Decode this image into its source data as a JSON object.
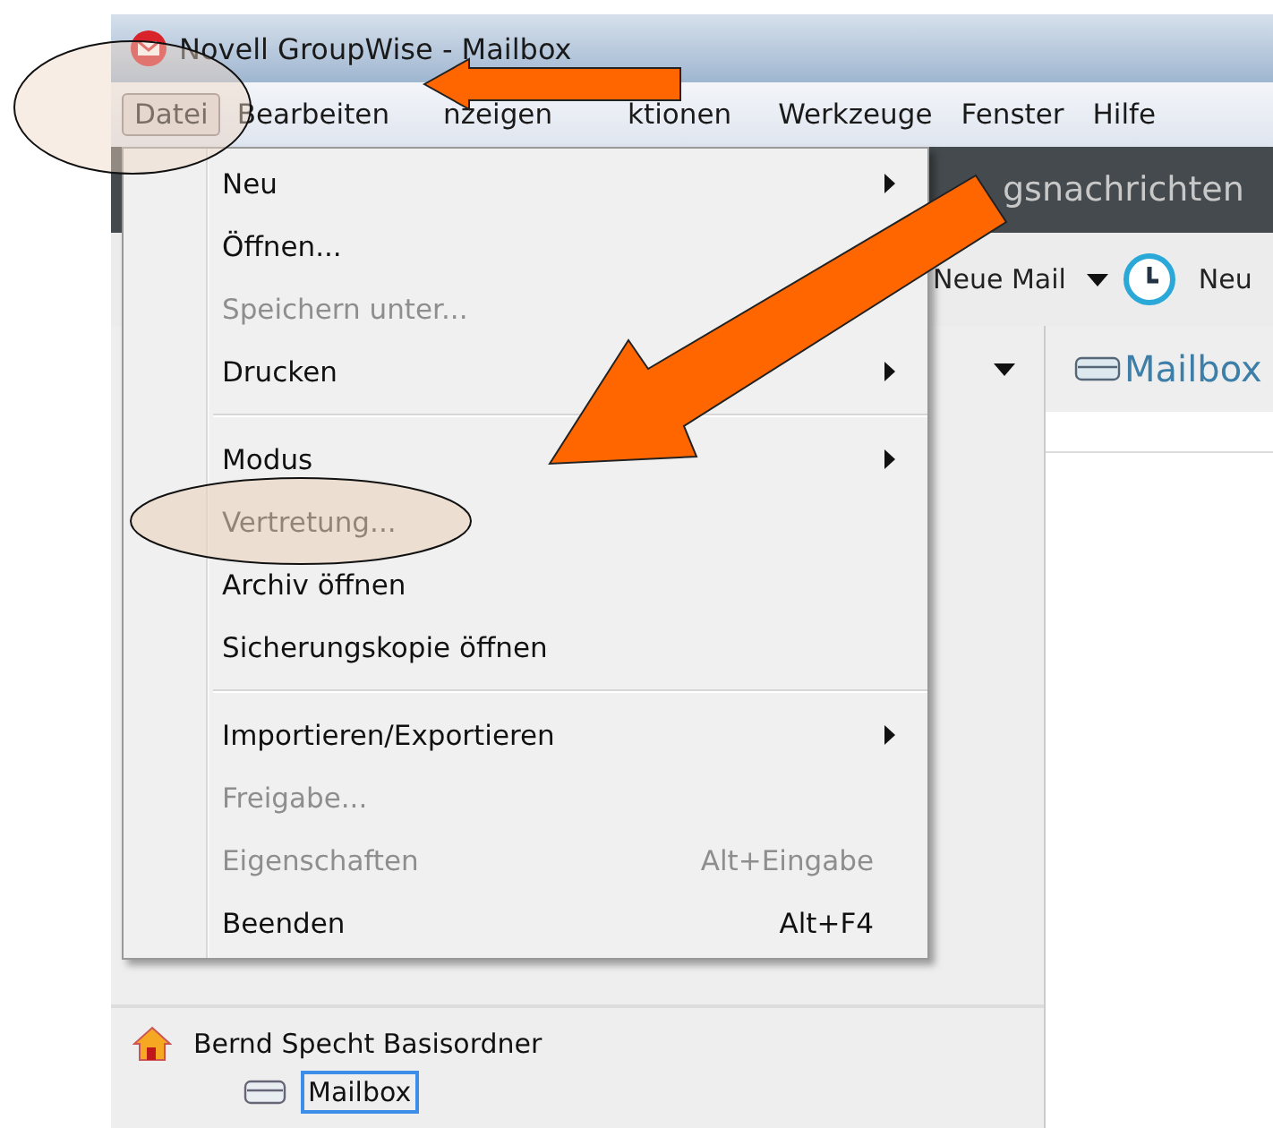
{
  "window": {
    "title": "Novell GroupWise - Mailbox"
  },
  "menubar": [
    {
      "label": "Datei",
      "selected": true
    },
    {
      "label": "Bearbeiten",
      "selected": false
    },
    {
      "label": "nzeigen",
      "selected": false
    },
    {
      "label": "ktionen",
      "selected": false
    },
    {
      "label": "Werkzeuge",
      "selected": false
    },
    {
      "label": "Fenster",
      "selected": false
    },
    {
      "label": "Hilfe",
      "selected": false
    }
  ],
  "menu": [
    {
      "kind": "item",
      "label": "Neu",
      "disabled": false,
      "submenu": true
    },
    {
      "kind": "item",
      "label": "Öffnen...",
      "disabled": false
    },
    {
      "kind": "item",
      "label": "Speichern unter...",
      "disabled": true
    },
    {
      "kind": "item",
      "label": "Drucken",
      "disabled": false,
      "submenu": true
    },
    {
      "kind": "separator"
    },
    {
      "kind": "item",
      "label": "Modus",
      "disabled": false,
      "submenu": true
    },
    {
      "kind": "item",
      "label": "Vertretung...",
      "disabled": false
    },
    {
      "kind": "item",
      "label": "Archiv öffnen",
      "disabled": false
    },
    {
      "kind": "item",
      "label": "Sicherungskopie öffnen",
      "disabled": false
    },
    {
      "kind": "separator"
    },
    {
      "kind": "item",
      "label": "Importieren/Exportieren",
      "disabled": false,
      "submenu": true
    },
    {
      "kind": "item",
      "label": "Freigabe...",
      "disabled": true
    },
    {
      "kind": "item",
      "label": "Eigenschaften",
      "disabled": true,
      "shortcut": "Alt+Eingabe"
    },
    {
      "kind": "item",
      "label": "Beenden",
      "disabled": false,
      "shortcut": "Alt+F4"
    }
  ],
  "banner": {
    "title": "gsnachrichten"
  },
  "toolbar": {
    "new_mail": "Neue Mail",
    "next": "Neu"
  },
  "panel": {
    "title": "Mailbox"
  },
  "folders": [
    {
      "label": "Bernd Specht Basisordner",
      "selected": false,
      "children": [
        {
          "label": "Mailbox",
          "selected": true
        }
      ]
    }
  ]
}
